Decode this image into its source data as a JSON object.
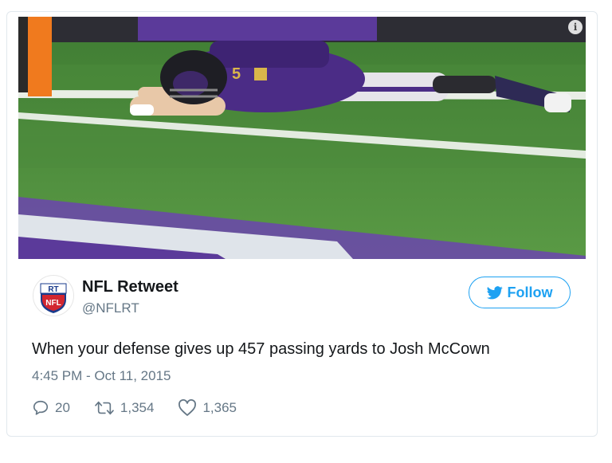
{
  "tweet": {
    "author_name": "NFL Retweet",
    "author_handle": "@NFLRT",
    "avatar_text_top": "RT",
    "avatar_text_bottom": "NFL",
    "follow_label": "Follow",
    "text": "When your defense gives up 457 passing yards to Josh McCown",
    "timestamp": "4:45 PM - Oct 11, 2015",
    "replies": "20",
    "retweets": "1,354",
    "likes": "1,365"
  },
  "media": {
    "info_label": "i",
    "jersey_number": "5"
  },
  "icons": {
    "info": "info-icon",
    "bird": "twitter-bird-icon",
    "reply": "reply-icon",
    "retweet": "retweet-icon",
    "like": "heart-icon"
  },
  "colors": {
    "twitter_blue": "#1da1f2",
    "secondary_text": "#657786",
    "primary_text": "#14171a",
    "field_green": "#4f8a3c",
    "ravens_purple": "#4b2c86"
  }
}
